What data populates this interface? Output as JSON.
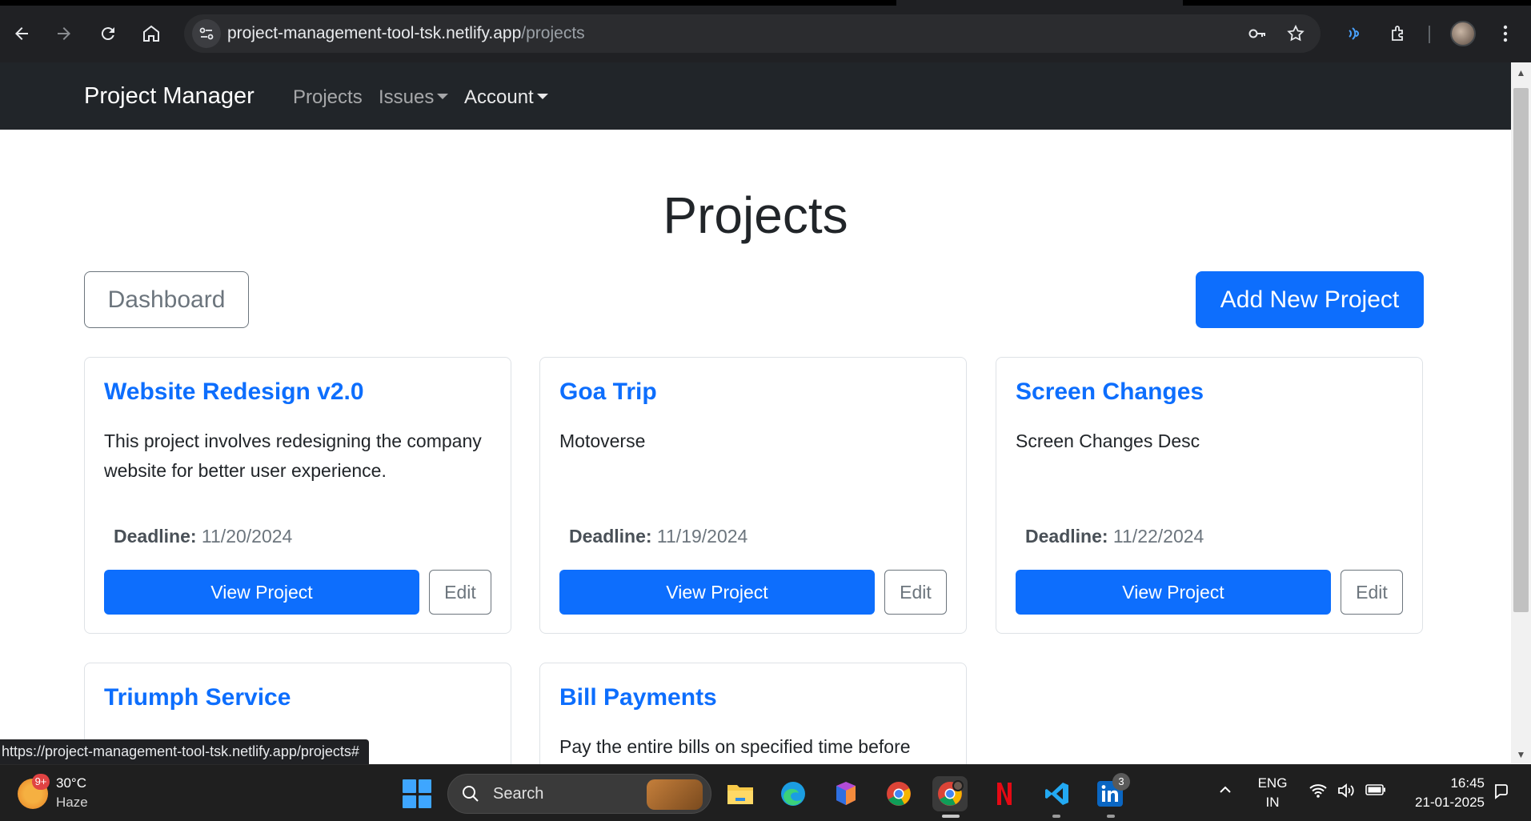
{
  "browser": {
    "url_host": "project-management-tool-tsk.netlify.app",
    "url_path": "/projects",
    "status_url": "https://project-management-tool-tsk.netlify.app/projects#"
  },
  "navbar": {
    "brand": "Project Manager",
    "links": [
      {
        "label": "Projects"
      },
      {
        "label": "Issues"
      },
      {
        "label": "Account"
      }
    ]
  },
  "page": {
    "title": "Projects",
    "dashboard_button": "Dashboard",
    "add_button": "Add New Project"
  },
  "projects": [
    {
      "title": "Website Redesign v2.0",
      "description": "This project involves redesigning the company website for better user experience.",
      "deadline_label": "Deadline:",
      "deadline": "11/20/2024",
      "view_label": "View Project",
      "edit_label": "Edit"
    },
    {
      "title": "Goa Trip",
      "description": "Motoverse",
      "deadline_label": "Deadline:",
      "deadline": "11/19/2024",
      "view_label": "View Project",
      "edit_label": "Edit"
    },
    {
      "title": "Screen Changes",
      "description": "Screen Changes Desc",
      "deadline_label": "Deadline:",
      "deadline": "11/22/2024",
      "view_label": "View Project",
      "edit_label": "Edit"
    },
    {
      "title": "Triumph Service",
      "description": ""
    },
    {
      "title": "Bill Payments",
      "description": "Pay the entire bills on specified time before"
    }
  ],
  "taskbar": {
    "weather_badge": "9+",
    "weather_temp": "30°C",
    "weather_condition": "Haze",
    "search_label": "Search",
    "linkedin_badge": "3",
    "language_top": "ENG",
    "language_bottom": "IN",
    "time": "16:45",
    "date": "21-01-2025",
    "apps": [
      "file-explorer",
      "edge",
      "m365",
      "chrome",
      "chrome-profile",
      "netflix",
      "vscode",
      "linkedin"
    ]
  },
  "colors": {
    "primary": "#0d6efd",
    "navbar_bg": "#212529",
    "chrome_bg": "#202124",
    "taskbar_bg": "#1f1f1f"
  }
}
